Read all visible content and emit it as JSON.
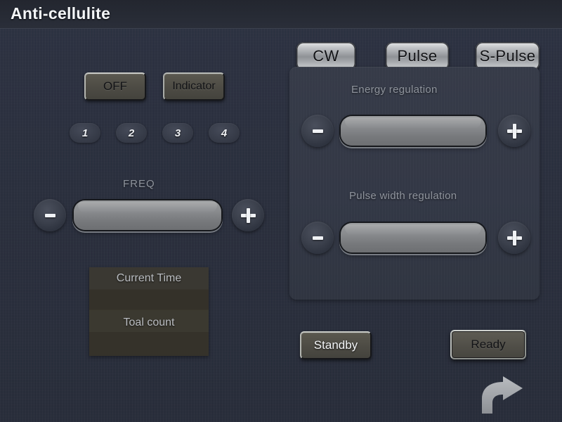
{
  "header": {
    "title": "Anti-cellulite"
  },
  "left_controls": {
    "off_button": "OFF",
    "indicator_button": "Indicator",
    "presets": [
      {
        "label": "1"
      },
      {
        "label": "2"
      },
      {
        "label": "3"
      },
      {
        "label": "4"
      }
    ],
    "freq": {
      "label": "FREQ",
      "minus_label": "-",
      "plus_label": "+",
      "value": ""
    },
    "info_panel": {
      "current_time_label": "Current Time",
      "current_time_value": "",
      "total_count_label": "Toal count",
      "total_count_value": ""
    }
  },
  "mode_buttons": [
    {
      "label": "CW"
    },
    {
      "label": "Pulse"
    },
    {
      "label": "S-Pulse"
    }
  ],
  "regulation_panel": {
    "energy": {
      "label": "Energy regulation",
      "minus_label": "-",
      "plus_label": "+",
      "value": ""
    },
    "pulse_width": {
      "label": "Pulse width regulation",
      "minus_label": "-",
      "plus_label": "+",
      "value": ""
    }
  },
  "status_buttons": {
    "standby": "Standby",
    "ready": "Ready"
  },
  "icons": {
    "next_arrow": "curved-right-arrow-icon"
  },
  "colors": {
    "background": "#2b3040",
    "header": "#262a34",
    "panel": "#343946",
    "silver_button": "#c3c5c8",
    "bevel_button": "#4e4c45",
    "info_panel": "#3a3832",
    "label_text": "#8f949d",
    "title_text": "#f4f6f8"
  }
}
